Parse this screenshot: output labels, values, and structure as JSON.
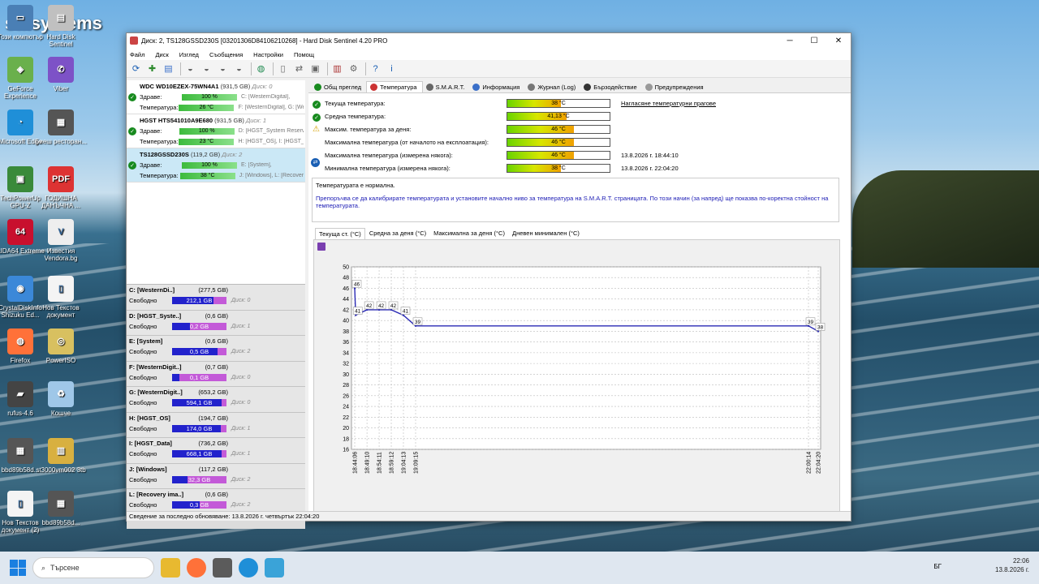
{
  "desktop": {
    "brand": "satsystems",
    "icons": [
      {
        "label": "Този компютър",
        "color": "#4a7fb5",
        "glyph": "▭"
      },
      {
        "label": "Hard Disk Sentinel",
        "color": "#c0c0c0",
        "glyph": "▤"
      },
      {
        "label": "GeForce Experience",
        "color": "#6ab04c",
        "glyph": "◈"
      },
      {
        "label": "Viber",
        "color": "#7d52c7",
        "glyph": "✆"
      },
      {
        "label": "Microsoft Edge",
        "color": "#1f8fd8",
        "glyph": "◔"
      },
      {
        "label": "Биеш ресторан...",
        "color": "#555",
        "glyph": "▦"
      },
      {
        "label": "TechPowerUp GPU-Z",
        "color": "#3a8a3a",
        "glyph": "▣"
      },
      {
        "label": "ГОДИШНА ДАНЪЧНА ...",
        "color": "#d33",
        "glyph": "PDF"
      },
      {
        "label": "AIDA64 Extreme",
        "color": "#c8102e",
        "glyph": "64"
      },
      {
        "label": "Известия Vendora.bg",
        "color": "#eee",
        "glyph": "V"
      },
      {
        "label": "CrystalDiskInfo Shizuku Ed...",
        "color": "#3b88d8",
        "glyph": "◉"
      },
      {
        "label": "Нов Текстов документ",
        "color": "#f4f4f4",
        "glyph": "▯"
      },
      {
        "label": "Firefox",
        "color": "#ff7139",
        "glyph": "◍"
      },
      {
        "label": "PowerISO",
        "color": "#d8c060",
        "glyph": "◎"
      },
      {
        "label": "rufus-4.6",
        "color": "#444",
        "glyph": "▰"
      },
      {
        "label": "Кошче",
        "color": "#9fc7e8",
        "glyph": "♻"
      },
      {
        "label": "bbd89b58d...",
        "color": "#555",
        "glyph": "▦"
      },
      {
        "label": "st3000vm002 3tb",
        "color": "#d8b040",
        "glyph": "▥"
      },
      {
        "label": "Нов Текстов документ (2)",
        "color": "#f4f4f4",
        "glyph": "▯"
      },
      {
        "label": "bbd89b58d...",
        "color": "#555",
        "glyph": "▦"
      }
    ]
  },
  "window": {
    "title": "Диск: 2, TS128GSSD230S [03201306D84106210268] - Hard Disk Sentinel 4.20 PRO",
    "menu": [
      "Файл",
      "Диск",
      "Изглед",
      "Съобщения",
      "Настройки",
      "Помощ"
    ],
    "toolbar_icons": [
      "refresh-icon",
      "health-icon",
      "disk-info-icon",
      "sep",
      "surface-test-icon",
      "surface-read-icon",
      "surface-write-icon",
      "surface-refresh-icon",
      "sep",
      "web-icon",
      "sep",
      "report-icon",
      "send-report-icon",
      "save-report-icon",
      "sep",
      "alert-icon",
      "settings-icon",
      "sep",
      "help-icon",
      "info-icon"
    ]
  },
  "disks": [
    {
      "name": "WDC WD10EZEX-75WN4A1",
      "size": "(931,5 GB)",
      "disk": "Диск: 0",
      "health": "100 %",
      "temp": "26 °C",
      "health_parts": "C: [WesternDigital],",
      "temp_parts": "F: [WesternDigital], G: [Wes"
    },
    {
      "name": "HGST HTS541010A9E680",
      "size": "(931,5 GB)",
      "disk": "Диск: 1",
      "health": "100 %",
      "temp": "23 °C",
      "health_parts": "D: [HGST_System Reserve",
      "temp_parts": "H: [HGST_OS], I: [HGST_D"
    },
    {
      "name": "TS128GSSD230S",
      "size": "(119,2 GB)",
      "disk": "Диск: 2",
      "health": "100 %",
      "temp": "38 °C",
      "health_parts": "E: [System],",
      "temp_parts": "J: [Windows], L: [Recovery"
    }
  ],
  "labels": {
    "health": "Здраве:",
    "temperature": "Температура:",
    "free": "Свободно"
  },
  "volumes": [
    {
      "name": "C: [WesternDi..]",
      "size": "(277,5 GB)",
      "free": "212,1 GB",
      "disk": "Диск: 0",
      "pct": 0.76
    },
    {
      "name": "D: [HGST_Syste..]",
      "size": "(0,6 GB)",
      "free": "0,2 GB",
      "disk": "Диск: 1",
      "pct": 0.33
    },
    {
      "name": "E: [System]",
      "size": "(0,6 GB)",
      "free": "0,5 GB",
      "disk": "Диск: 2",
      "pct": 0.83
    },
    {
      "name": "F: [WesternDigit..]",
      "size": "(0,7 GB)",
      "free": "0,1 GB",
      "disk": "Диск: 0",
      "pct": 0.14
    },
    {
      "name": "G: [WesternDigit..]",
      "size": "(653,2 GB)",
      "free": "594,1 GB",
      "disk": "Диск: 0",
      "pct": 0.91
    },
    {
      "name": "H: [HGST_OS]",
      "size": "(194,7 GB)",
      "free": "174,0 GB",
      "disk": "Диск: 1",
      "pct": 0.89
    },
    {
      "name": "I: [HGST_Data]",
      "size": "(736,2 GB)",
      "free": "668,1 GB",
      "disk": "Диск: 1",
      "pct": 0.91
    },
    {
      "name": "J: [Windows]",
      "size": "(117,2 GB)",
      "free": "32,3 GB",
      "disk": "Диск: 2",
      "pct": 0.28
    },
    {
      "name": "L: [Recovery ima..]",
      "size": "(0,6 GB)",
      "free": "0,3 GB",
      "disk": "Диск: 2",
      "pct": 0.5
    }
  ],
  "tabs": [
    {
      "label": "Общ преглед",
      "color": "#178a1e"
    },
    {
      "label": "Температура",
      "color": "#c33"
    },
    {
      "label": "S.M.A.R.T.",
      "color": "#666"
    },
    {
      "label": "Информация",
      "color": "#3a6fc9"
    },
    {
      "label": "Журнал (Log)",
      "color": "#777"
    },
    {
      "label": "Бързодействие",
      "color": "#333"
    },
    {
      "label": "Предупреждения",
      "color": "#999"
    }
  ],
  "temperature": {
    "rows": [
      {
        "label": "Текуща температура:",
        "value": "38 °C",
        "fill": 0.52,
        "status": "ok",
        "extra": "Нагласяне температурни прагове"
      },
      {
        "label": "Средна температура:",
        "value": "41,13 °C",
        "fill": 0.58,
        "status": "ok",
        "extra": ""
      },
      {
        "label": "Максим. температура за деня:",
        "value": "46 °C",
        "fill": 0.65,
        "status": "warn",
        "extra": ""
      },
      {
        "label": "Максимална температура (от началото на експлоатация):",
        "value": "46 °C",
        "fill": 0.65,
        "status": "none",
        "extra": ""
      },
      {
        "label": "Максимална температура (измерена някога):",
        "value": "46 °C",
        "fill": 0.65,
        "status": "none",
        "extra": "13.8.2026 г. 18:44:10"
      },
      {
        "label": "Минимална температура (измерена някога):",
        "value": "38 °C",
        "fill": 0.52,
        "status": "none",
        "extra": "13.8.2026 г. 22:04:20"
      }
    ],
    "note_line1": "Температурата е нормална.",
    "note_line2": "Препоръчва се да калибрирате температурата и установите начално ниво за температура на S.M.A.R.T. страницата. По този начин (за напред) ще показва по-коректна стойност на температурата."
  },
  "chart_tabs": [
    "Текуща ст. (°C)",
    "Средна за деня (°C)",
    "Максимална за деня (°C)",
    "Дневен минимален (°C)"
  ],
  "chart_data": {
    "type": "line",
    "ylim": [
      16,
      50
    ],
    "y_ticks": [
      16,
      18,
      20,
      22,
      24,
      26,
      28,
      30,
      32,
      34,
      36,
      38,
      40,
      42,
      44,
      46,
      48,
      50
    ],
    "x_tick_labels": [
      "18:44:06",
      "18:49:10",
      "18:54:11",
      "18:59:12",
      "19:04:13",
      "19:09:15",
      "22:00:14",
      "22:04:20"
    ],
    "points": [
      {
        "x": "18:44:06",
        "y": 46,
        "label": "46"
      },
      {
        "x": "18:44:30",
        "y": 41,
        "label": "41"
      },
      {
        "x": "18:49:10",
        "y": 42,
        "label": "42"
      },
      {
        "x": "18:54:11",
        "y": 42,
        "label": "42"
      },
      {
        "x": "18:59:12",
        "y": 42,
        "label": "42"
      },
      {
        "x": "19:04:13",
        "y": 41,
        "label": "41"
      },
      {
        "x": "19:09:15",
        "y": 39,
        "label": "39"
      },
      {
        "x": "22:00:14",
        "y": 39,
        "label": "39"
      },
      {
        "x": "22:04:20",
        "y": 38,
        "label": "38"
      }
    ],
    "color": "#2b2bb5",
    "grid": true
  },
  "status_text": "Сведение за последно обновяване: 13.8.2026 г. четвъртък 22:04:20",
  "taskbar": {
    "search_placeholder": "Търсене",
    "lang": "БГ",
    "time": "22:06",
    "date": "13.8.2026 г."
  }
}
